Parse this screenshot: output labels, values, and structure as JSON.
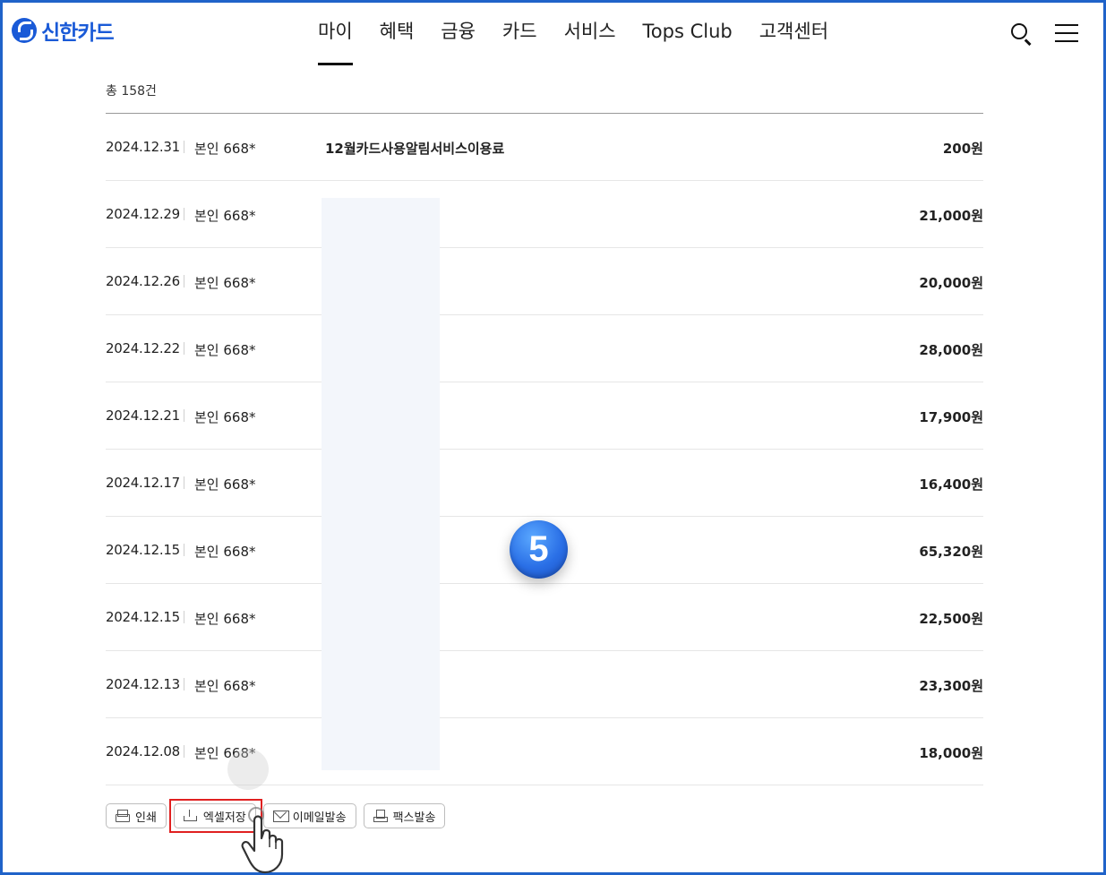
{
  "header": {
    "brand": "신한카드",
    "nav": [
      {
        "label": "마이",
        "active": true
      },
      {
        "label": "혜택",
        "active": false
      },
      {
        "label": "금융",
        "active": false
      },
      {
        "label": "카드",
        "active": false
      },
      {
        "label": "서비스",
        "active": false
      },
      {
        "label": "Tops Club",
        "active": false
      },
      {
        "label": "고객센터",
        "active": false
      }
    ],
    "icons": [
      "search-icon",
      "menu-icon"
    ]
  },
  "summary": {
    "count_text": "총 158건"
  },
  "transactions": [
    {
      "date": "2024.12.31",
      "holder": "본인 668*",
      "merchant": "12월카드사용알림서비스이용료",
      "amount": "200원"
    },
    {
      "date": "2024.12.29",
      "holder": "본인 668*",
      "merchant": "",
      "amount": "21,000원"
    },
    {
      "date": "2024.12.26",
      "holder": "본인 668*",
      "merchant": "",
      "amount": "20,000원"
    },
    {
      "date": "2024.12.22",
      "holder": "본인 668*",
      "merchant": "",
      "amount": "28,000원"
    },
    {
      "date": "2024.12.21",
      "holder": "본인 668*",
      "merchant": "",
      "amount": "17,900원"
    },
    {
      "date": "2024.12.17",
      "holder": "본인 668*",
      "merchant": "",
      "amount": "16,400원"
    },
    {
      "date": "2024.12.15",
      "holder": "본인 668*",
      "merchant": "",
      "amount": "65,320원"
    },
    {
      "date": "2024.12.15",
      "holder": "본인 668*",
      "merchant": "",
      "amount": "22,500원"
    },
    {
      "date": "2024.12.13",
      "holder": "본인 668*",
      "merchant": "",
      "amount": "23,300원"
    },
    {
      "date": "2024.12.08",
      "holder": "본인 668*",
      "merchant": "",
      "amount": "18,000원"
    }
  ],
  "actions": {
    "print": "인쇄",
    "excel": "엑셀저장",
    "email": "이메일발송",
    "fax": "팩스발송"
  },
  "step_badge": "5",
  "colors": {
    "brand": "#1a5ad7",
    "highlight": "#e02020",
    "frame": "#1f63c9"
  }
}
